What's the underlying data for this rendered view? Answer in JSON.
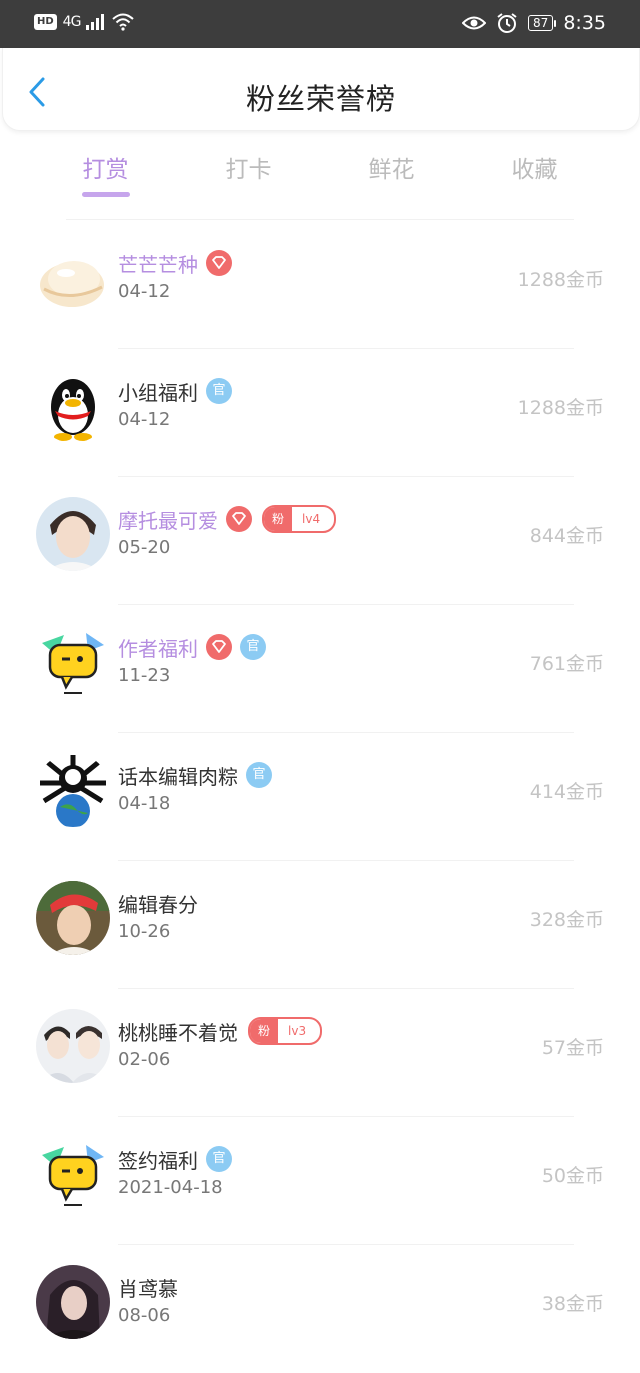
{
  "status_bar": {
    "hd": "HD",
    "network": "4G",
    "battery": "87",
    "time": "8:35"
  },
  "header": {
    "title": "粉丝荣誉榜"
  },
  "tabs": [
    {
      "label": "打赏"
    },
    {
      "label": "打卡"
    },
    {
      "label": "鲜花"
    },
    {
      "label": "收藏"
    }
  ],
  "rows": [
    {
      "name": "芒芒芒种",
      "date": "04-12",
      "amount": "1288金币"
    },
    {
      "name": "小组福利",
      "date": "04-12",
      "amount": "1288金币",
      "badge": "官"
    },
    {
      "name": "摩托最可爱",
      "date": "05-20",
      "amount": "844金币",
      "fan_label": "粉",
      "fan_level": "lv4"
    },
    {
      "name": "作者福利",
      "date": "11-23",
      "amount": "761金币",
      "badge": "官"
    },
    {
      "name": "话本编辑肉粽",
      "date": "04-18",
      "amount": "414金币",
      "badge": "官"
    },
    {
      "name": "编辑春分",
      "date": "10-26",
      "amount": "328金币"
    },
    {
      "name": "桃桃睡不着觉",
      "date": "02-06",
      "amount": "57金币",
      "fan_label": "粉",
      "fan_level": "lv3"
    },
    {
      "name": "签约福利",
      "date": "2021-04-18",
      "amount": "50金币",
      "badge": "官"
    },
    {
      "name": "肖鸢慕",
      "date": "08-06",
      "amount": "38金币"
    }
  ],
  "colors": {
    "accent": "#b58ee0",
    "gem_badge": "#f06b6b",
    "official_badge": "#8ccbf3",
    "amount": "#c4c4c4"
  }
}
